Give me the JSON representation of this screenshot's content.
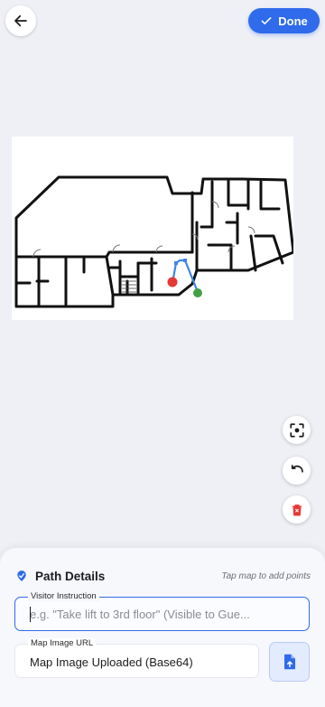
{
  "header": {
    "back_icon": "arrow-left-icon",
    "done_label": "Done",
    "done_icon": "check-icon"
  },
  "map": {
    "path_start_color": "#e53935",
    "path_end_color": "#43a047",
    "path_line_color": "#3f86e6"
  },
  "tools": {
    "fit_icon": "focus-frame-icon",
    "undo_icon": "undo-icon",
    "clear_icon": "trash-icon"
  },
  "sheet": {
    "title": "Path Details",
    "hint": "Tap map to add points",
    "instruction": {
      "label": "Visitor Instruction",
      "placeholder": "e.g. \"Take lift to 3rd floor\" (Visible to Gue...",
      "value": ""
    },
    "map_url": {
      "label": "Map Image URL",
      "value": "Map Image Uploaded (Base64)"
    },
    "upload_icon": "file-upload-icon"
  },
  "colors": {
    "accent": "#2f6bea",
    "danger": "#e53935",
    "background": "#eef0f6"
  }
}
